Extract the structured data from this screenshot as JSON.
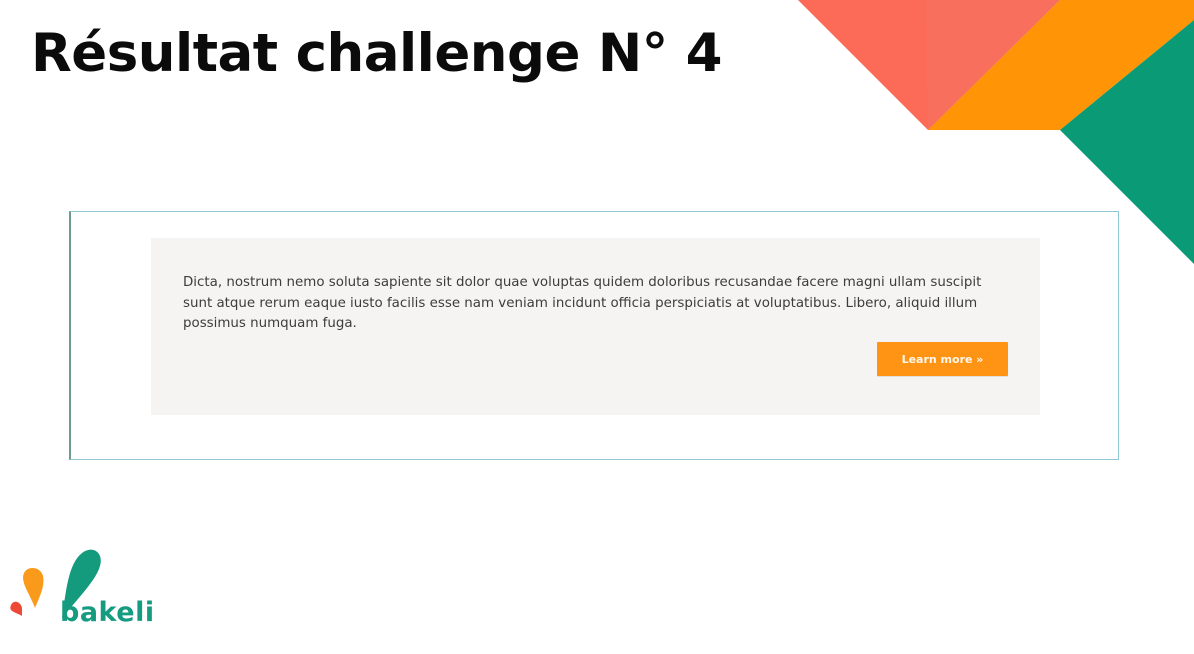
{
  "slide": {
    "title": "Résultat challenge N° 4"
  },
  "card": {
    "text": "Dicta, nostrum nemo soluta sapiente sit dolor quae voluptas quidem doloribus recusandae facere magni ullam suscipit sunt atque rerum eaque iusto facilis esse nam veniam incidunt officia perspiciatis at voluptatibus. Libero, aliquid illum possimus numquam fuga.",
    "button_label": "Learn more »",
    "background_color": "#f5f4f2",
    "button_color": "#ff9414"
  },
  "logo": {
    "text": "bakeli",
    "color": "#159b80"
  },
  "decoration": {
    "colors": [
      "#fb6b58",
      "#ff9506",
      "#0a9a75"
    ]
  }
}
